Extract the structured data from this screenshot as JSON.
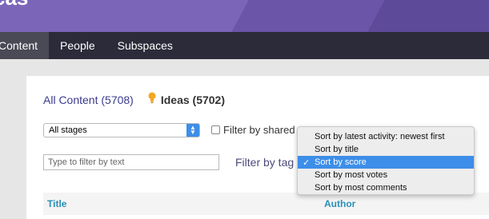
{
  "banner": {
    "title": "cas"
  },
  "nav": {
    "tabs": [
      {
        "label": "Content",
        "active": true
      },
      {
        "label": "People",
        "active": false
      },
      {
        "label": "Subspaces",
        "active": false
      }
    ]
  },
  "counts": {
    "all_content": "All Content (5708)",
    "ideas": "Ideas (5702)"
  },
  "filters": {
    "stage_selected": "All stages",
    "shared_label": "Filter by shared",
    "text_placeholder": "Type to filter by text",
    "tag_label": "Filter by tag"
  },
  "table": {
    "columns": [
      "Title",
      "Author"
    ]
  },
  "sort_menu": {
    "items": [
      {
        "label": "Sort by latest activity: newest first",
        "selected": false
      },
      {
        "label": "Sort by title",
        "selected": false
      },
      {
        "label": "Sort by score",
        "selected": true
      },
      {
        "label": "Sort by most votes",
        "selected": false
      },
      {
        "label": "Sort by most comments",
        "selected": false
      }
    ],
    "check_glyph": "✓"
  },
  "colors": {
    "accent": "#3d8ee8",
    "banner": "#7b65b9",
    "navbar": "#2b2b3a",
    "column_header": "#2a8fb8"
  }
}
